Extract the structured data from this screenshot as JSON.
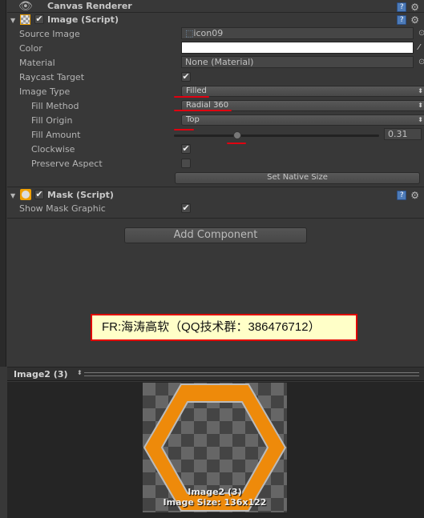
{
  "canvas_renderer": {
    "title": "Canvas Renderer",
    "icon": "eye-icon"
  },
  "image_script": {
    "title": "Image (Script)",
    "enabled": true,
    "source_image": {
      "label": "Source Image",
      "value": "icon09"
    },
    "color": {
      "label": "Color",
      "value": "#ffffff"
    },
    "material": {
      "label": "Material",
      "value": "None (Material)"
    },
    "raycast_target": {
      "label": "Raycast Target",
      "checked": true
    },
    "image_type": {
      "label": "Image Type",
      "value": "Filled"
    },
    "fill_method": {
      "label": "Fill Method",
      "value": "Radial 360"
    },
    "fill_origin": {
      "label": "Fill Origin",
      "value": "Top"
    },
    "fill_amount": {
      "label": "Fill Amount",
      "value": "0.31"
    },
    "clockwise": {
      "label": "Clockwise",
      "checked": true
    },
    "preserve_aspect": {
      "label": "Preserve Aspect",
      "checked": false
    },
    "set_native_size": "Set Native Size"
  },
  "mask_script": {
    "title": "Mask (Script)",
    "enabled": true,
    "show_mask_graphic": {
      "label": "Show Mask Graphic",
      "checked": true
    }
  },
  "add_component": "Add Component",
  "watermark": "FR:海涛高软（QQ技术群：386476712）",
  "preview": {
    "title": "Image2 (3)",
    "caption_name": "Image2 (3)",
    "caption_size": "Image Size: 136x122",
    "ring_color": "#ee8a0a"
  }
}
